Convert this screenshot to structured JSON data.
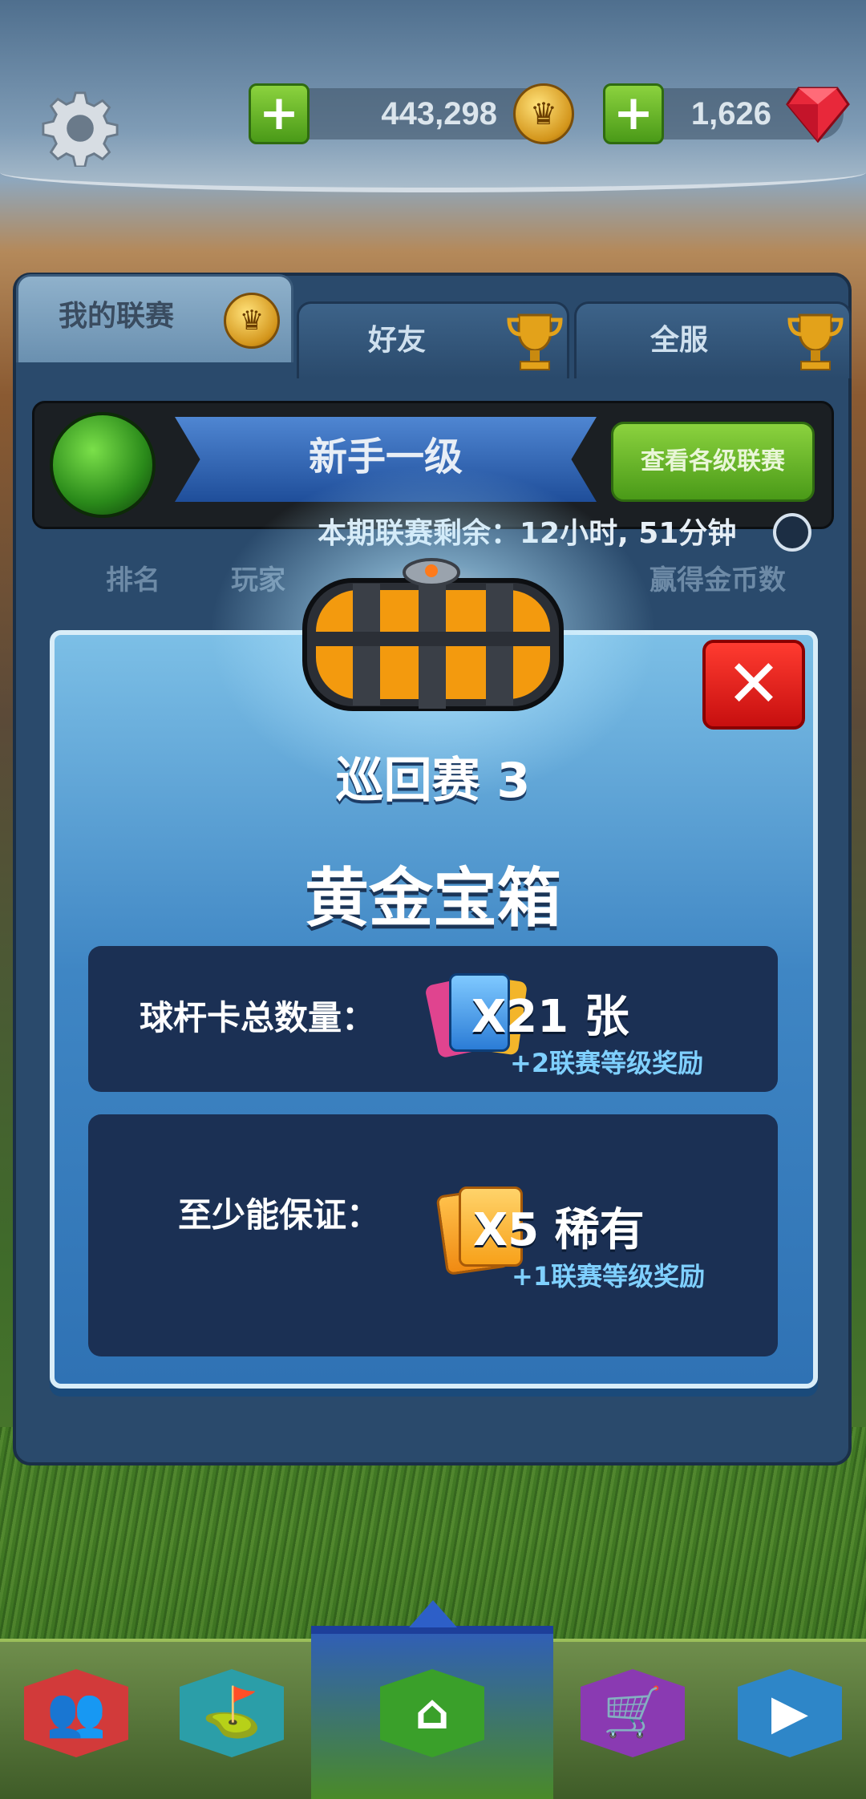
{
  "header": {
    "coins": "443,298",
    "gems": "1,626"
  },
  "tabs": [
    {
      "label": "我的联赛"
    },
    {
      "label": "好友"
    },
    {
      "label": "全服"
    }
  ],
  "league": {
    "level": "新手一级",
    "view_button": "查看各级联赛",
    "remaining": "本期联赛剩余：12小时, 51分钟"
  },
  "columns": {
    "rank": "排名",
    "player": "玩家",
    "coins": "赢得金币数"
  },
  "dialog": {
    "tour": "巡回赛 3",
    "chest_name": "黄金宝箱",
    "total_label": "球杆卡总数量：",
    "total_qty": "X21 张",
    "total_bonus": "+2联赛等级奖励",
    "guarantee_label": "至少能保证：",
    "guarantee_qty": "X5 稀有",
    "guarantee_bonus": "+1联赛等级奖励"
  },
  "nav": [
    {
      "icon": "social-icon"
    },
    {
      "icon": "golf-bag-icon"
    },
    {
      "icon": "home-icon"
    },
    {
      "icon": "shop-cart-icon"
    },
    {
      "icon": "tv-replay-icon"
    }
  ],
  "colors": {
    "accent_green": "#4a9a18",
    "close_red": "#c70f0f",
    "dialog_blue": "#3f86c4"
  }
}
